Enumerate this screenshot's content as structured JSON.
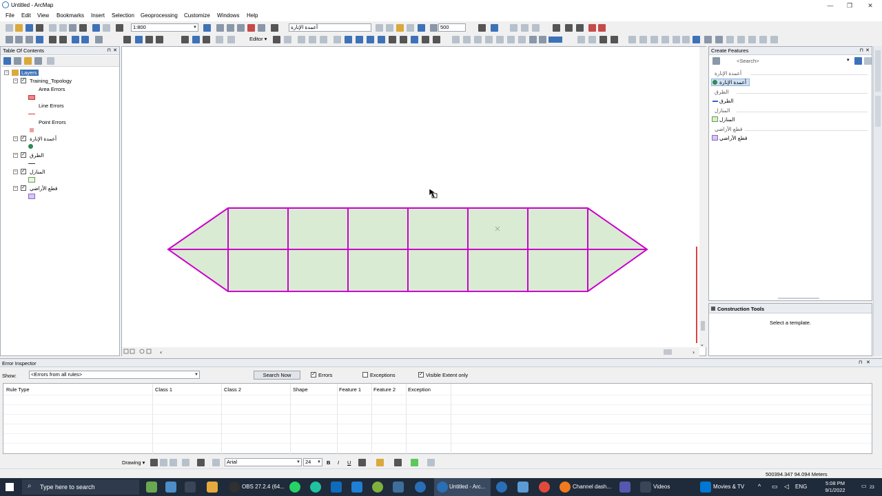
{
  "window": {
    "title": "Untitled - ArcMap"
  },
  "menu": [
    "File",
    "Edit",
    "View",
    "Bookmarks",
    "Insert",
    "Selection",
    "Geoprocessing",
    "Customize",
    "Windows",
    "Help"
  ],
  "toolbar": {
    "scale": "1:800",
    "layer_combo": "أعمدة الإنارة",
    "zoom_value": "500",
    "editor_label": "Editor ▾"
  },
  "toc": {
    "title": "Table Of Contents",
    "root": "Layers",
    "layers": [
      {
        "name": "Training_Topology",
        "children": [
          "Area Errors",
          "Line Errors",
          "Point Errors"
        ]
      },
      {
        "name": "أعمدة الإنارة"
      },
      {
        "name": "الطرق"
      },
      {
        "name": "المنازل"
      },
      {
        "name": "قطع الأراضي"
      }
    ]
  },
  "create_features": {
    "title": "Create Features",
    "search_placeholder": "<Search>",
    "groups": [
      {
        "header": "أعمدة الإنارة",
        "item": "أعمدة الإنارة",
        "icon": "point-icon",
        "color": "#2e8b57"
      },
      {
        "header": "الطرق",
        "item": "الطرق",
        "icon": "line-icon",
        "color": "#3a5fcd"
      },
      {
        "header": "المنازل",
        "item": "المنازل",
        "icon": "polygon-icon",
        "color": "#d8f0c8"
      },
      {
        "header": "قطع الأراضي",
        "item": "قطع الأراضي",
        "icon": "polygon-icon",
        "color": "#d6c6f2"
      }
    ]
  },
  "construction_tools": {
    "title": "Construction Tools",
    "message": "Select a template."
  },
  "error_inspector": {
    "title": "Error Inspector",
    "show_label": "Show:",
    "show_value": "<Errors from all rules>",
    "search_button": "Search Now",
    "errors_label": "Errors",
    "exceptions_label": "Exceptions",
    "visible_extent_label": "Visible Extent only",
    "columns": [
      "Rule Type",
      "Class 1",
      "Class 2",
      "Shape",
      "Feature 1",
      "Feature 2",
      "Exception"
    ]
  },
  "drawing": {
    "label": "Drawing ▾",
    "font": "Arial",
    "size": "24",
    "bold": "B",
    "italic": "I",
    "underline": "U"
  },
  "status": {
    "coords": "500394.347  94.094 Meters"
  },
  "taskbar": {
    "search_placeholder": "Type here to search",
    "apps": [
      "OBS 27.2.4 (64...",
      "Untitled - Arc...",
      "Channel dash...",
      "Videos",
      "Movies & TV"
    ],
    "lang": "ENG",
    "time": "5:08 PM",
    "date": "9/1/2022",
    "notif": "23"
  },
  "colors": {
    "parcel_fill": "#d9ebd3",
    "parcel_outline": "#cc00cc",
    "error_marker": "#e04040",
    "accent": "#3d72b8"
  }
}
